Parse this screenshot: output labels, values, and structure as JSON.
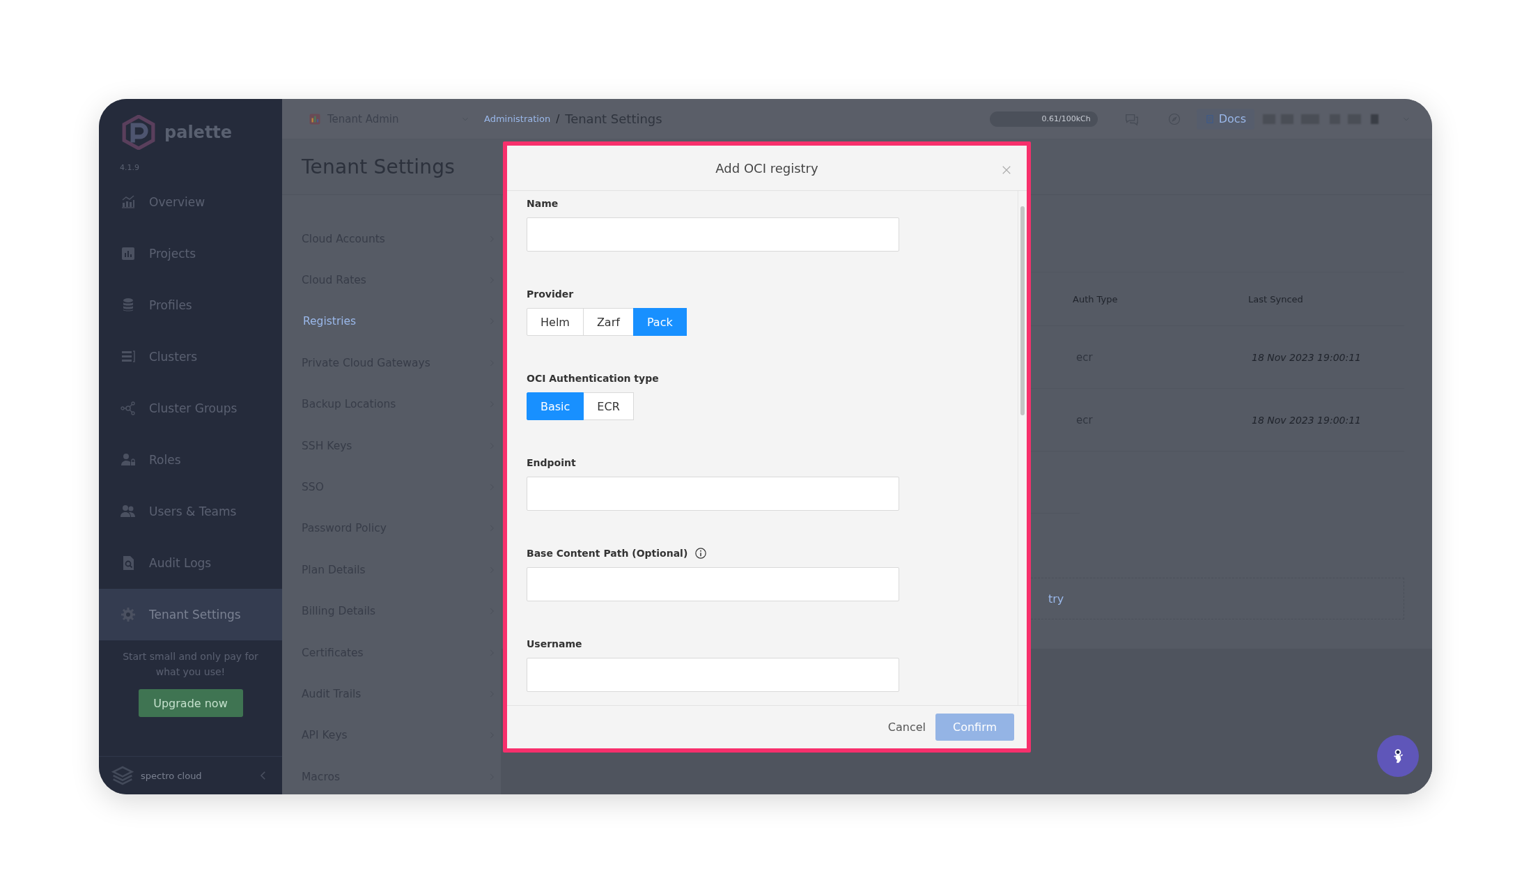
{
  "sidebar": {
    "brand": "palette",
    "version": "4.1.9",
    "items": [
      {
        "label": "Overview",
        "selected": false
      },
      {
        "label": "Projects",
        "selected": false
      },
      {
        "label": "Profiles",
        "selected": false
      },
      {
        "label": "Clusters",
        "selected": false
      },
      {
        "label": "Cluster Groups",
        "selected": false
      },
      {
        "label": "Roles",
        "selected": false
      },
      {
        "label": "Users & Teams",
        "selected": false
      },
      {
        "label": "Audit Logs",
        "selected": false
      },
      {
        "label": "Tenant Settings",
        "selected": true
      }
    ],
    "promo": "Start small and only pay for what you use!",
    "upgrade_button": "Upgrade now",
    "footer_brand": "spectro cloud"
  },
  "top_bar": {
    "workspace": "Tenant Admin",
    "breadcrumb": [
      "Administration",
      "Tenant Settings"
    ],
    "separator": "/",
    "usage": "0.61/100kCh",
    "docs_button": "Docs"
  },
  "settings_menu": {
    "title": "Tenant Settings",
    "items": [
      {
        "label": "Cloud Accounts",
        "selected": false
      },
      {
        "label": "Cloud Rates",
        "selected": false
      },
      {
        "label": "Registries",
        "selected": true
      },
      {
        "label": "Private Cloud Gateways",
        "selected": false
      },
      {
        "label": "Backup Locations",
        "selected": false
      },
      {
        "label": "SSH Keys",
        "selected": false
      },
      {
        "label": "SSO",
        "selected": false
      },
      {
        "label": "Password Policy",
        "selected": false
      },
      {
        "label": "Plan Details",
        "selected": false
      },
      {
        "label": "Billing Details",
        "selected": false
      },
      {
        "label": "Certificates",
        "selected": false
      },
      {
        "label": "Audit Trails",
        "selected": false
      },
      {
        "label": "API Keys",
        "selected": false
      },
      {
        "label": "Macros",
        "selected": false
      }
    ]
  },
  "registries_table": {
    "columns": [
      "Auth Type",
      "Last Synced"
    ],
    "rows": [
      {
        "auth_type": "ecr",
        "last_synced": "18 Nov 2023 19:00:11"
      },
      {
        "auth_type": "ecr",
        "last_synced": "18 Nov 2023 19:00:11"
      }
    ],
    "add_link": "try"
  },
  "dialog": {
    "title": "Add OCI registry",
    "fields": [
      {
        "kind": "text",
        "label": "Name",
        "info": false
      },
      {
        "kind": "segmented",
        "label": "Provider",
        "options": [
          {
            "label": "Helm",
            "selected": false
          },
          {
            "label": "Zarf",
            "selected": false
          },
          {
            "label": "Pack",
            "selected": true
          }
        ]
      },
      {
        "kind": "segmented",
        "label": "OCI Authentication type",
        "options": [
          {
            "label": "Basic",
            "selected": true
          },
          {
            "label": "ECR",
            "selected": false
          }
        ]
      },
      {
        "kind": "text",
        "label": "Endpoint",
        "info": false
      },
      {
        "kind": "text",
        "label": "Base Content Path (Optional)",
        "info": true
      },
      {
        "kind": "text",
        "label": "Username",
        "info": false
      }
    ],
    "cancel_button": "Cancel",
    "confirm_button": {
      "label": "Confirm",
      "disabled": true
    }
  }
}
